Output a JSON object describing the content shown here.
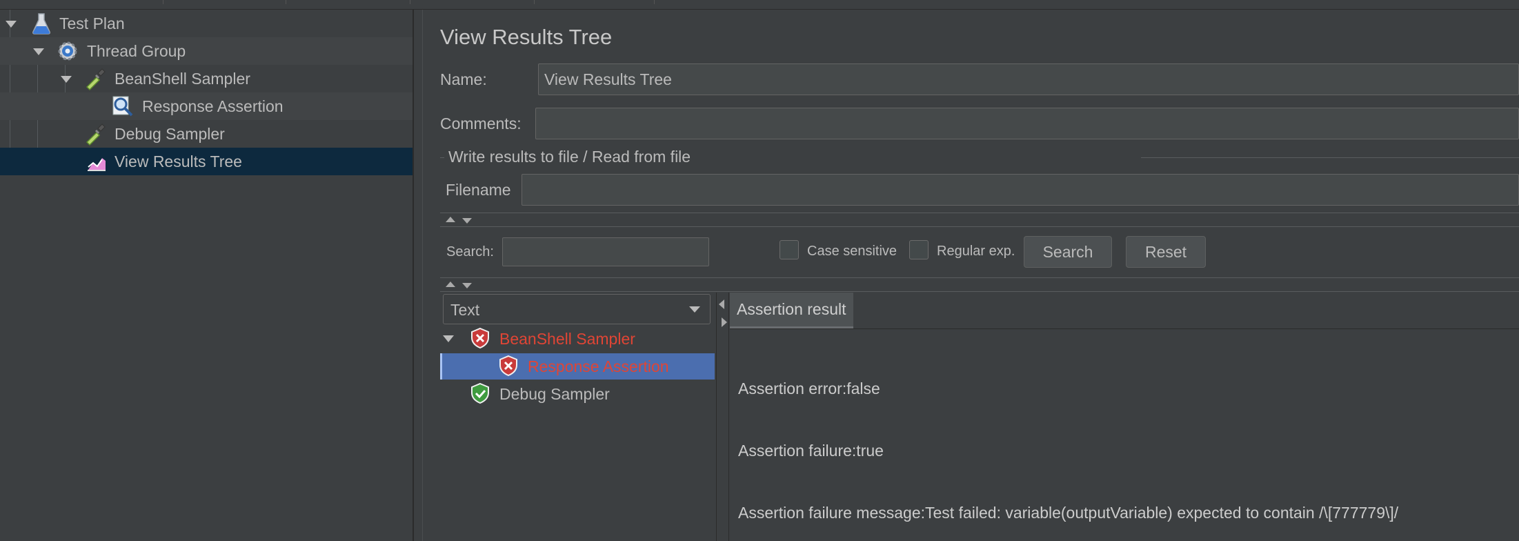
{
  "tree": {
    "items": [
      {
        "label": "Test Plan",
        "icon": "flask-icon"
      },
      {
        "label": "Thread Group",
        "icon": "gear-icon"
      },
      {
        "label": "BeanShell Sampler",
        "icon": "pipette-icon"
      },
      {
        "label": "Response Assertion",
        "icon": "magnifier-icon"
      },
      {
        "label": "Debug Sampler",
        "icon": "pipette-icon"
      },
      {
        "label": "View Results Tree",
        "icon": "chart-icon"
      }
    ],
    "selected_index": 5
  },
  "panel": {
    "title": "View Results Tree",
    "name_label": "Name:",
    "name_value": "View Results Tree",
    "comments_label": "Comments:",
    "comments_value": "",
    "file_group_title": "Write results to file / Read from file",
    "filename_label": "Filename",
    "filename_value": ""
  },
  "search": {
    "label": "Search:",
    "value": "",
    "case_sensitive_label": "Case sensitive",
    "regex_label": "Regular exp.",
    "search_button": "Search",
    "reset_button": "Reset"
  },
  "results": {
    "renderer": "Text",
    "items": [
      {
        "label": "BeanShell Sampler",
        "status": "error"
      },
      {
        "label": "Response Assertion",
        "status": "error"
      },
      {
        "label": "Debug Sampler",
        "status": "success"
      }
    ],
    "selected_index": 1,
    "tab_label": "Assertion result",
    "lines": [
      "Assertion error:false",
      "Assertion failure:true",
      "Assertion failure message:Test failed: variable(outputVariable) expected to contain /\\[777779\\]/"
    ]
  },
  "colors": {
    "error_text": "#e04535",
    "selection_bg": "#4b6eaf",
    "tree_selected_bg": "#0d293e"
  }
}
